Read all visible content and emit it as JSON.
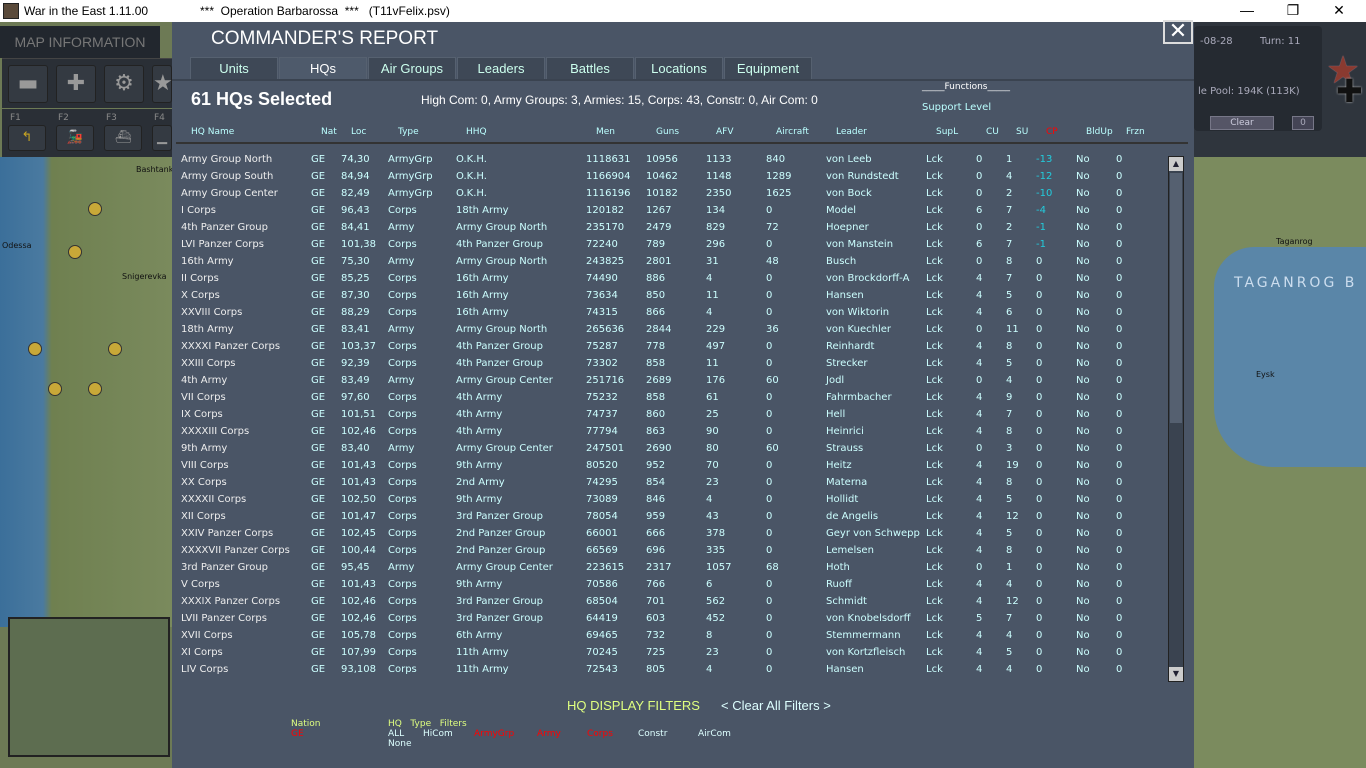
{
  "window": {
    "app_title": "War in the East 1.11.00",
    "document_title": "***  Operation Barbarossa  ***   (T11vFelix.psv)",
    "minimize": "—",
    "maximize": "❐",
    "close": "✕"
  },
  "left_panel": {
    "map_information": "MAP INFORMATION",
    "function_keys": [
      "F1",
      "F2",
      "F3",
      "F4"
    ],
    "map_labels": [
      "Bashtanka",
      "Odessa",
      "Snigerevka"
    ]
  },
  "right_panel": {
    "date": "-08-28",
    "turn": "Turn: 11",
    "pool": "le Pool: 194K (113K)",
    "clear": "Clear",
    "counter": "0",
    "map_labels": [
      "Taganrog",
      "TAGANROG B",
      "Eysk"
    ]
  },
  "report": {
    "title": "COMMANDER'S REPORT",
    "close": "✕",
    "tabs": [
      "Units",
      "HQs",
      "Air Groups",
      "Leaders",
      "Battles",
      "Locations",
      "Equipment"
    ],
    "active_tab": "HQs",
    "selected_count": "61 HQs Selected",
    "summary": "High Com: 0, Army Groups: 3, Armies: 15, Corps: 43, Constr: 0, Air Com: 0",
    "functions_label": "_____Functions_____",
    "support_level_label": "Support Level",
    "columns": [
      "HQ Name",
      "Nat",
      "Loc",
      "Type",
      "HHQ",
      "Men",
      "Guns",
      "AFV",
      "Aircraft",
      "Leader",
      "SupL",
      "CU",
      "SU",
      "CP",
      "BldUp",
      "Frzn"
    ],
    "rows": [
      [
        "Army Group North",
        "GE",
        "74,30",
        "ArmyGrp",
        "O.K.H.",
        "1118631",
        "10956",
        "1133",
        "840",
        "von Leeb",
        "Lck",
        "0",
        "1",
        "-13",
        "No",
        "0"
      ],
      [
        "Army Group South",
        "GE",
        "84,94",
        "ArmyGrp",
        "O.K.H.",
        "1166904",
        "10462",
        "1148",
        "1289",
        "von Rundstedt",
        "Lck",
        "0",
        "4",
        "-12",
        "No",
        "0"
      ],
      [
        "Army Group Center",
        "GE",
        "82,49",
        "ArmyGrp",
        "O.K.H.",
        "1116196",
        "10182",
        "2350",
        "1625",
        "von Bock",
        "Lck",
        "0",
        "2",
        "-10",
        "No",
        "0"
      ],
      [
        "I Corps",
        "GE",
        "96,43",
        "Corps",
        "18th Army",
        "120182",
        "1267",
        "134",
        "0",
        "Model",
        "Lck",
        "6",
        "7",
        "-4",
        "No",
        "0"
      ],
      [
        "4th Panzer Group",
        "GE",
        "84,41",
        "Army",
        "Army Group North",
        "235170",
        "2479",
        "829",
        "72",
        "Hoepner",
        "Lck",
        "0",
        "2",
        "-1",
        "No",
        "0"
      ],
      [
        "LVI Panzer Corps",
        "GE",
        "101,38",
        "Corps",
        "4th Panzer Group",
        "72240",
        "789",
        "296",
        "0",
        "von Manstein",
        "Lck",
        "6",
        "7",
        "-1",
        "No",
        "0"
      ],
      [
        "16th Army",
        "GE",
        "75,30",
        "Army",
        "Army Group North",
        "243825",
        "2801",
        "31",
        "48",
        "Busch",
        "Lck",
        "0",
        "8",
        "0",
        "No",
        "0"
      ],
      [
        "II Corps",
        "GE",
        "85,25",
        "Corps",
        "16th Army",
        "74490",
        "886",
        "4",
        "0",
        "von Brockdorff-A",
        "Lck",
        "4",
        "7",
        "0",
        "No",
        "0"
      ],
      [
        "X Corps",
        "GE",
        "87,30",
        "Corps",
        "16th Army",
        "73634",
        "850",
        "11",
        "0",
        "Hansen",
        "Lck",
        "4",
        "5",
        "0",
        "No",
        "0"
      ],
      [
        "XXVIII Corps",
        "GE",
        "88,29",
        "Corps",
        "16th Army",
        "74315",
        "866",
        "4",
        "0",
        "von Wiktorin",
        "Lck",
        "4",
        "6",
        "0",
        "No",
        "0"
      ],
      [
        "18th Army",
        "GE",
        "83,41",
        "Army",
        "Army Group North",
        "265636",
        "2844",
        "229",
        "36",
        "von Kuechler",
        "Lck",
        "0",
        "11",
        "0",
        "No",
        "0"
      ],
      [
        "XXXXI Panzer Corps",
        "GE",
        "103,37",
        "Corps",
        "4th Panzer Group",
        "75287",
        "778",
        "497",
        "0",
        "Reinhardt",
        "Lck",
        "4",
        "8",
        "0",
        "No",
        "0"
      ],
      [
        "XXIII Corps",
        "GE",
        "92,39",
        "Corps",
        "4th Panzer Group",
        "73302",
        "858",
        "11",
        "0",
        "Strecker",
        "Lck",
        "4",
        "5",
        "0",
        "No",
        "0"
      ],
      [
        "4th Army",
        "GE",
        "83,49",
        "Army",
        "Army Group Center",
        "251716",
        "2689",
        "176",
        "60",
        "Jodl",
        "Lck",
        "0",
        "4",
        "0",
        "No",
        "0"
      ],
      [
        "VII Corps",
        "GE",
        "97,60",
        "Corps",
        "4th Army",
        "75232",
        "858",
        "61",
        "0",
        "Fahrmbacher",
        "Lck",
        "4",
        "9",
        "0",
        "No",
        "0"
      ],
      [
        "IX Corps",
        "GE",
        "101,51",
        "Corps",
        "4th Army",
        "74737",
        "860",
        "25",
        "0",
        "Hell",
        "Lck",
        "4",
        "7",
        "0",
        "No",
        "0"
      ],
      [
        "XXXXIII Corps",
        "GE",
        "102,46",
        "Corps",
        "4th Army",
        "77794",
        "863",
        "90",
        "0",
        "Heinrici",
        "Lck",
        "4",
        "8",
        "0",
        "No",
        "0"
      ],
      [
        "9th Army",
        "GE",
        "83,40",
        "Army",
        "Army Group Center",
        "247501",
        "2690",
        "80",
        "60",
        "Strauss",
        "Lck",
        "0",
        "3",
        "0",
        "No",
        "0"
      ],
      [
        "VIII Corps",
        "GE",
        "101,43",
        "Corps",
        "9th Army",
        "80520",
        "952",
        "70",
        "0",
        "Heitz",
        "Lck",
        "4",
        "19",
        "0",
        "No",
        "0"
      ],
      [
        "XX Corps",
        "GE",
        "101,43",
        "Corps",
        "2nd Army",
        "74295",
        "854",
        "23",
        "0",
        "Materna",
        "Lck",
        "4",
        "8",
        "0",
        "No",
        "0"
      ],
      [
        "XXXXII Corps",
        "GE",
        "102,50",
        "Corps",
        "9th Army",
        "73089",
        "846",
        "4",
        "0",
        "Hollidt",
        "Lck",
        "4",
        "5",
        "0",
        "No",
        "0"
      ],
      [
        "XII Corps",
        "GE",
        "101,47",
        "Corps",
        "3rd Panzer Group",
        "78054",
        "959",
        "43",
        "0",
        "de Angelis",
        "Lck",
        "4",
        "12",
        "0",
        "No",
        "0"
      ],
      [
        "XXIV Panzer Corps",
        "GE",
        "102,45",
        "Corps",
        "2nd Panzer Group",
        "66001",
        "666",
        "378",
        "0",
        "Geyr von Schwepp",
        "Lck",
        "4",
        "5",
        "0",
        "No",
        "0"
      ],
      [
        "XXXXVII Panzer Corps",
        "GE",
        "100,44",
        "Corps",
        "2nd Panzer Group",
        "66569",
        "696",
        "335",
        "0",
        "Lemelsen",
        "Lck",
        "4",
        "8",
        "0",
        "No",
        "0"
      ],
      [
        "3rd Panzer Group",
        "GE",
        "95,45",
        "Army",
        "Army Group Center",
        "223615",
        "2317",
        "1057",
        "68",
        "Hoth",
        "Lck",
        "0",
        "1",
        "0",
        "No",
        "0"
      ],
      [
        "V Corps",
        "GE",
        "101,43",
        "Corps",
        "9th Army",
        "70586",
        "766",
        "6",
        "0",
        "Ruoff",
        "Lck",
        "4",
        "4",
        "0",
        "No",
        "0"
      ],
      [
        "XXXIX Panzer Corps",
        "GE",
        "102,46",
        "Corps",
        "3rd Panzer Group",
        "68504",
        "701",
        "562",
        "0",
        "Schmidt",
        "Lck",
        "4",
        "12",
        "0",
        "No",
        "0"
      ],
      [
        "LVII Panzer Corps",
        "GE",
        "102,46",
        "Corps",
        "3rd Panzer Group",
        "64419",
        "603",
        "452",
        "0",
        "von Knobelsdorff",
        "Lck",
        "5",
        "7",
        "0",
        "No",
        "0"
      ],
      [
        "XVII Corps",
        "GE",
        "105,78",
        "Corps",
        "6th Army",
        "69465",
        "732",
        "8",
        "0",
        "Stemmermann",
        "Lck",
        "4",
        "4",
        "0",
        "No",
        "0"
      ],
      [
        "XI Corps",
        "GE",
        "107,99",
        "Corps",
        "11th Army",
        "70245",
        "725",
        "23",
        "0",
        "von Kortzfleisch",
        "Lck",
        "4",
        "5",
        "0",
        "No",
        "0"
      ],
      [
        "LIV Corps",
        "GE",
        "93,108",
        "Corps",
        "11th Army",
        "72543",
        "805",
        "4",
        "0",
        "Hansen",
        "Lck",
        "4",
        "4",
        "0",
        "No",
        "0"
      ]
    ],
    "filters": {
      "title": "HQ DISPLAY FILTERS",
      "clear_all": "< Clear All Filters >",
      "nation_label": "Nation",
      "nation_value": "GE",
      "type_label": "HQ   Type   Filters",
      "type_options": [
        "ALL",
        "HiCom",
        "ArmyGrp",
        "Army",
        "Corps",
        "Constr",
        "AirCom"
      ],
      "none": "None"
    },
    "colors": {
      "background": "#4a5566",
      "active_filter": "#ff0000",
      "cp_negative": "#22ccdd",
      "filter_title": "#dfff80"
    }
  }
}
